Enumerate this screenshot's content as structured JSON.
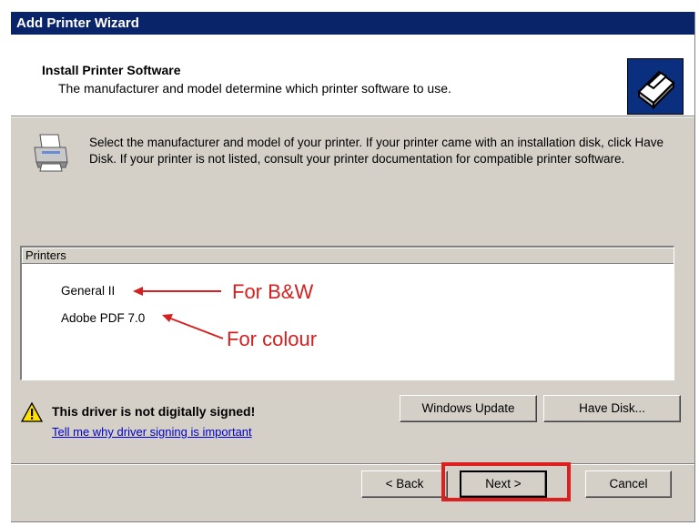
{
  "window": {
    "title": "Add Printer Wizard"
  },
  "header": {
    "title": "Install Printer Software",
    "subtitle": "The manufacturer and model determine which printer software to use."
  },
  "instructions": "Select the manufacturer and model of your printer. If your printer came with an installation disk, click Have Disk. If your printer is not listed, consult your printer documentation for compatible printer software.",
  "printers": {
    "column_header": "Printers",
    "items": [
      "General II",
      "Adobe PDF 7.0"
    ]
  },
  "annotations": {
    "bw": "For B&W",
    "colour": "For colour",
    "color": "#d42020"
  },
  "warning": {
    "text": "This driver is not digitally signed!",
    "link": "Tell me why driver signing is important"
  },
  "buttons": {
    "windows_update": "Windows Update",
    "have_disk": "Have Disk...",
    "back": "< Back",
    "next": "Next >",
    "cancel": "Cancel"
  },
  "colors": {
    "titlebar": "#0a246a",
    "dialog": "#d4d0c8",
    "highlight": "#dd1f1f"
  }
}
